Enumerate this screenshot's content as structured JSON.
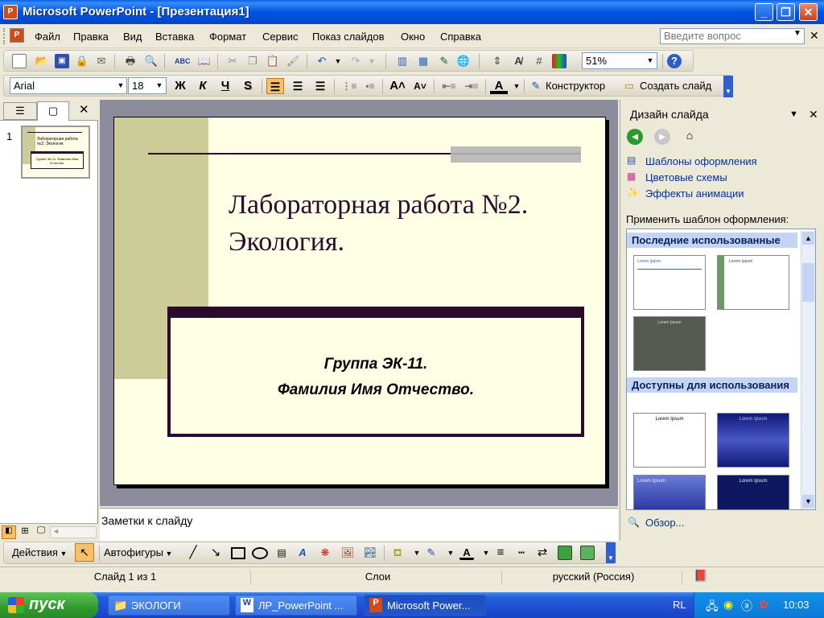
{
  "window": {
    "title": "Microsoft PowerPoint - [Презентация1]",
    "app_icon": "P"
  },
  "menu": {
    "items": [
      "Файл",
      "Правка",
      "Вид",
      "Вставка",
      "Формат",
      "Сервис",
      "Показ слайдов",
      "Окно",
      "Справка"
    ],
    "help_placeholder": "Введите вопрос"
  },
  "standard_toolbar": {
    "zoom": "51%"
  },
  "format_toolbar": {
    "font": "Arial",
    "size": "18",
    "bold": "Ж",
    "italic": "К",
    "underline": "Ч",
    "shadow": "S",
    "designer_label": "Конструктор",
    "new_slide_label": "Создать слайд"
  },
  "slides_panel": {
    "slide_number": "1",
    "thumb_title": "Лабораторная работа №2. Экология.",
    "thumb_sub": "Группа ЭК-11. Фамилия Имя Отчество."
  },
  "slide": {
    "title_line1": "Лабораторная работа №2.",
    "title_line2": "Экология.",
    "subtitle_line1": "Группа ЭК-11.",
    "subtitle_line2": "Фамилия Имя Отчество."
  },
  "notes": {
    "placeholder": "Заметки к слайду"
  },
  "task_pane": {
    "title": "Дизайн слайда",
    "links": [
      "Шаблоны оформления",
      "Цветовые схемы",
      "Эффекты анимации"
    ],
    "apply_label": "Применить шаблон оформления:",
    "recent_header": "Последние использованные",
    "available_header": "Доступны для использования",
    "browse_label": "Обзор...",
    "template_text": "Lorem Ipsum"
  },
  "draw_toolbar": {
    "actions_label": "Действия",
    "autoshapes_label": "Автофигуры"
  },
  "status": {
    "slide": "Слайд 1 из 1",
    "layers": "Слои",
    "language": "русский (Россия)"
  },
  "taskbar": {
    "start_label": "пуск",
    "tasks": [
      "ЭКОЛОГИ",
      "ЛР_PowerPoint ...",
      "Microsoft Power..."
    ],
    "lang": "RL",
    "clock": "10:03"
  },
  "colors": {
    "accent": "#2b0a2e",
    "slide_bg": "#ffffe6",
    "side_band": "#cccc99",
    "title_blue": "#0054e3"
  }
}
